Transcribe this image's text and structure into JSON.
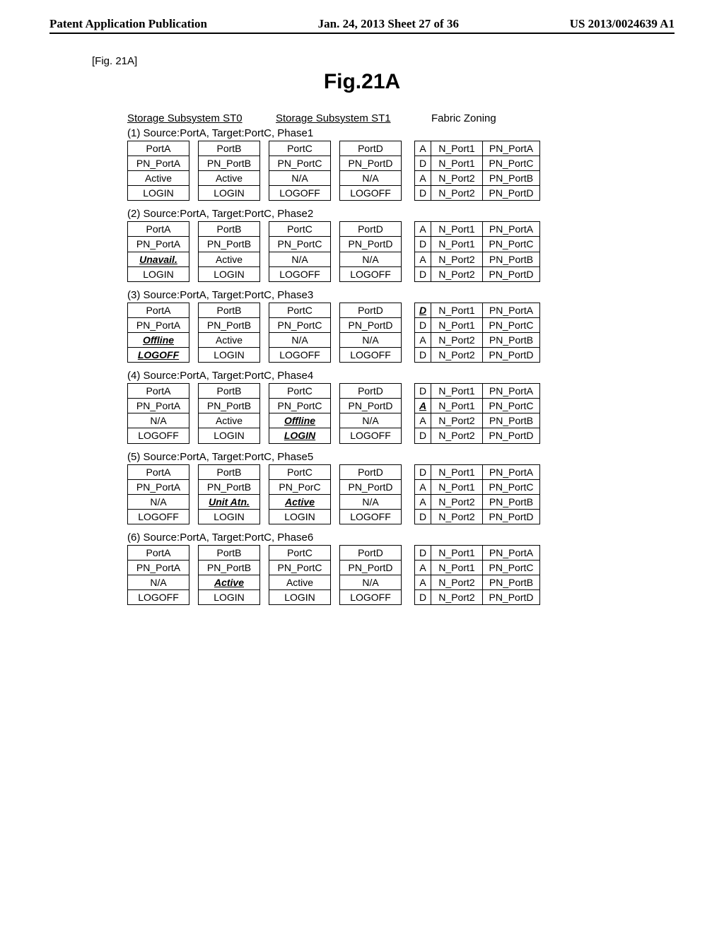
{
  "header": {
    "left": "Patent Application Publication",
    "mid": "Jan. 24, 2013  Sheet 27 of 36",
    "right": "US 2013/0024639 A1"
  },
  "figlabel_small": "[Fig. 21A]",
  "figtitle": "Fig.21A",
  "section_heads": {
    "st0": "Storage Subsystem ST0",
    "st1": "Storage Subsystem ST1",
    "fabric": "Fabric Zoning"
  },
  "phases": [
    {
      "label": "(1) Source:PortA, Target:PortC, Phase1",
      "ports": [
        {
          "cells": [
            {
              "t": "PortA"
            },
            {
              "t": "PN_PortA"
            },
            {
              "t": "Active"
            },
            {
              "t": "LOGIN"
            }
          ]
        },
        {
          "cells": [
            {
              "t": "PortB"
            },
            {
              "t": "PN_PortB"
            },
            {
              "t": "Active"
            },
            {
              "t": "LOGIN"
            }
          ]
        },
        {
          "cells": [
            {
              "t": "PortC"
            },
            {
              "t": "PN_PortC"
            },
            {
              "t": "N/A"
            },
            {
              "t": "LOGOFF"
            }
          ]
        },
        {
          "cells": [
            {
              "t": "PortD"
            },
            {
              "t": "PN_PortD"
            },
            {
              "t": "N/A"
            },
            {
              "t": "LOGOFF"
            }
          ]
        }
      ],
      "zoning": [
        [
          {
            "t": "A"
          },
          {
            "t": "N_Port1"
          },
          {
            "t": "PN_PortA"
          }
        ],
        [
          {
            "t": "D"
          },
          {
            "t": "N_Port1"
          },
          {
            "t": "PN_PortC"
          }
        ],
        [
          {
            "t": "A"
          },
          {
            "t": "N_Port2"
          },
          {
            "t": "PN_PortB"
          }
        ],
        [
          {
            "t": "D"
          },
          {
            "t": "N_Port2"
          },
          {
            "t": "PN_PortD"
          }
        ]
      ]
    },
    {
      "label": "(2) Source:PortA, Target:PortC, Phase2",
      "ports": [
        {
          "cells": [
            {
              "t": "PortA"
            },
            {
              "t": "PN_PortA"
            },
            {
              "t": "Unavail.",
              "e": true
            },
            {
              "t": "LOGIN"
            }
          ]
        },
        {
          "cells": [
            {
              "t": "PortB"
            },
            {
              "t": "PN_PortB"
            },
            {
              "t": "Active"
            },
            {
              "t": "LOGIN"
            }
          ]
        },
        {
          "cells": [
            {
              "t": "PortC"
            },
            {
              "t": "PN_PortC"
            },
            {
              "t": "N/A"
            },
            {
              "t": "LOGOFF"
            }
          ]
        },
        {
          "cells": [
            {
              "t": "PortD"
            },
            {
              "t": "PN_PortD"
            },
            {
              "t": "N/A"
            },
            {
              "t": "LOGOFF"
            }
          ]
        }
      ],
      "zoning": [
        [
          {
            "t": "A"
          },
          {
            "t": "N_Port1"
          },
          {
            "t": "PN_PortA"
          }
        ],
        [
          {
            "t": "D"
          },
          {
            "t": "N_Port1"
          },
          {
            "t": "PN_PortC"
          }
        ],
        [
          {
            "t": "A"
          },
          {
            "t": "N_Port2"
          },
          {
            "t": "PN_PortB"
          }
        ],
        [
          {
            "t": "D"
          },
          {
            "t": "N_Port2"
          },
          {
            "t": "PN_PortD"
          }
        ]
      ]
    },
    {
      "label": "(3) Source:PortA, Target:PortC, Phase3",
      "ports": [
        {
          "cells": [
            {
              "t": "PortA"
            },
            {
              "t": "PN_PortA"
            },
            {
              "t": "Offline",
              "e": true
            },
            {
              "t": "LOGOFF",
              "e": true
            }
          ]
        },
        {
          "cells": [
            {
              "t": "PortB"
            },
            {
              "t": "PN_PortB"
            },
            {
              "t": "Active"
            },
            {
              "t": "LOGIN"
            }
          ]
        },
        {
          "cells": [
            {
              "t": "PortC"
            },
            {
              "t": "PN_PortC"
            },
            {
              "t": "N/A"
            },
            {
              "t": "LOGOFF"
            }
          ]
        },
        {
          "cells": [
            {
              "t": "PortD"
            },
            {
              "t": "PN_PortD"
            },
            {
              "t": "N/A"
            },
            {
              "t": "LOGOFF"
            }
          ]
        }
      ],
      "zoning": [
        [
          {
            "t": "D",
            "e": true
          },
          {
            "t": "N_Port1"
          },
          {
            "t": "PN_PortA"
          }
        ],
        [
          {
            "t": "D"
          },
          {
            "t": "N_Port1"
          },
          {
            "t": "PN_PortC"
          }
        ],
        [
          {
            "t": "A"
          },
          {
            "t": "N_Port2"
          },
          {
            "t": "PN_PortB"
          }
        ],
        [
          {
            "t": "D"
          },
          {
            "t": "N_Port2"
          },
          {
            "t": "PN_PortD"
          }
        ]
      ]
    },
    {
      "label": "(4) Source:PortA, Target:PortC, Phase4",
      "ports": [
        {
          "cells": [
            {
              "t": "PortA"
            },
            {
              "t": "PN_PortA"
            },
            {
              "t": "N/A"
            },
            {
              "t": "LOGOFF"
            }
          ]
        },
        {
          "cells": [
            {
              "t": "PortB"
            },
            {
              "t": "PN_PortB"
            },
            {
              "t": "Active"
            },
            {
              "t": "LOGIN"
            }
          ]
        },
        {
          "cells": [
            {
              "t": "PortC"
            },
            {
              "t": "PN_PortC"
            },
            {
              "t": "Offline",
              "e": true
            },
            {
              "t": "LOGIN",
              "e": true
            }
          ]
        },
        {
          "cells": [
            {
              "t": "PortD"
            },
            {
              "t": "PN_PortD"
            },
            {
              "t": "N/A"
            },
            {
              "t": "LOGOFF"
            }
          ]
        }
      ],
      "zoning": [
        [
          {
            "t": "D"
          },
          {
            "t": "N_Port1"
          },
          {
            "t": "PN_PortA"
          }
        ],
        [
          {
            "t": "A",
            "e": true
          },
          {
            "t": "N_Port1"
          },
          {
            "t": "PN_PortC"
          }
        ],
        [
          {
            "t": "A"
          },
          {
            "t": "N_Port2"
          },
          {
            "t": "PN_PortB"
          }
        ],
        [
          {
            "t": "D"
          },
          {
            "t": "N_Port2"
          },
          {
            "t": "PN_PortD"
          }
        ]
      ]
    },
    {
      "label": "(5) Source:PortA, Target:PortC, Phase5",
      "ports": [
        {
          "cells": [
            {
              "t": "PortA"
            },
            {
              "t": "PN_PortA"
            },
            {
              "t": "N/A"
            },
            {
              "t": "LOGOFF"
            }
          ]
        },
        {
          "cells": [
            {
              "t": "PortB"
            },
            {
              "t": "PN_PortB"
            },
            {
              "t": "Unit Atn.",
              "e": true
            },
            {
              "t": "LOGIN"
            }
          ]
        },
        {
          "cells": [
            {
              "t": "PortC"
            },
            {
              "t": "PN_PorC"
            },
            {
              "t": "Active",
              "e": true
            },
            {
              "t": "LOGIN"
            }
          ]
        },
        {
          "cells": [
            {
              "t": "PortD"
            },
            {
              "t": "PN_PortD"
            },
            {
              "t": "N/A"
            },
            {
              "t": "LOGOFF"
            }
          ]
        }
      ],
      "zoning": [
        [
          {
            "t": "D"
          },
          {
            "t": "N_Port1"
          },
          {
            "t": "PN_PortA"
          }
        ],
        [
          {
            "t": "A"
          },
          {
            "t": "N_Port1"
          },
          {
            "t": "PN_PortC"
          }
        ],
        [
          {
            "t": "A"
          },
          {
            "t": "N_Port2"
          },
          {
            "t": "PN_PortB"
          }
        ],
        [
          {
            "t": "D"
          },
          {
            "t": "N_Port2"
          },
          {
            "t": "PN_PortD"
          }
        ]
      ]
    },
    {
      "label": "(6) Source:PortA, Target:PortC, Phase6",
      "ports": [
        {
          "cells": [
            {
              "t": "PortA"
            },
            {
              "t": "PN_PortA"
            },
            {
              "t": "N/A"
            },
            {
              "t": "LOGOFF"
            }
          ]
        },
        {
          "cells": [
            {
              "t": "PortB"
            },
            {
              "t": "PN_PortB"
            },
            {
              "t": "Active",
              "e": true
            },
            {
              "t": "LOGIN"
            }
          ]
        },
        {
          "cells": [
            {
              "t": "PortC"
            },
            {
              "t": "PN_PortC"
            },
            {
              "t": "Active"
            },
            {
              "t": "LOGIN"
            }
          ]
        },
        {
          "cells": [
            {
              "t": "PortD"
            },
            {
              "t": "PN_PortD"
            },
            {
              "t": "N/A"
            },
            {
              "t": "LOGOFF"
            }
          ]
        }
      ],
      "zoning": [
        [
          {
            "t": "D"
          },
          {
            "t": "N_Port1"
          },
          {
            "t": "PN_PortA"
          }
        ],
        [
          {
            "t": "A"
          },
          {
            "t": "N_Port1"
          },
          {
            "t": "PN_PortC"
          }
        ],
        [
          {
            "t": "A"
          },
          {
            "t": "N_Port2"
          },
          {
            "t": "PN_PortB"
          }
        ],
        [
          {
            "t": "D"
          },
          {
            "t": "N_Port2"
          },
          {
            "t": "PN_PortD"
          }
        ]
      ]
    }
  ]
}
